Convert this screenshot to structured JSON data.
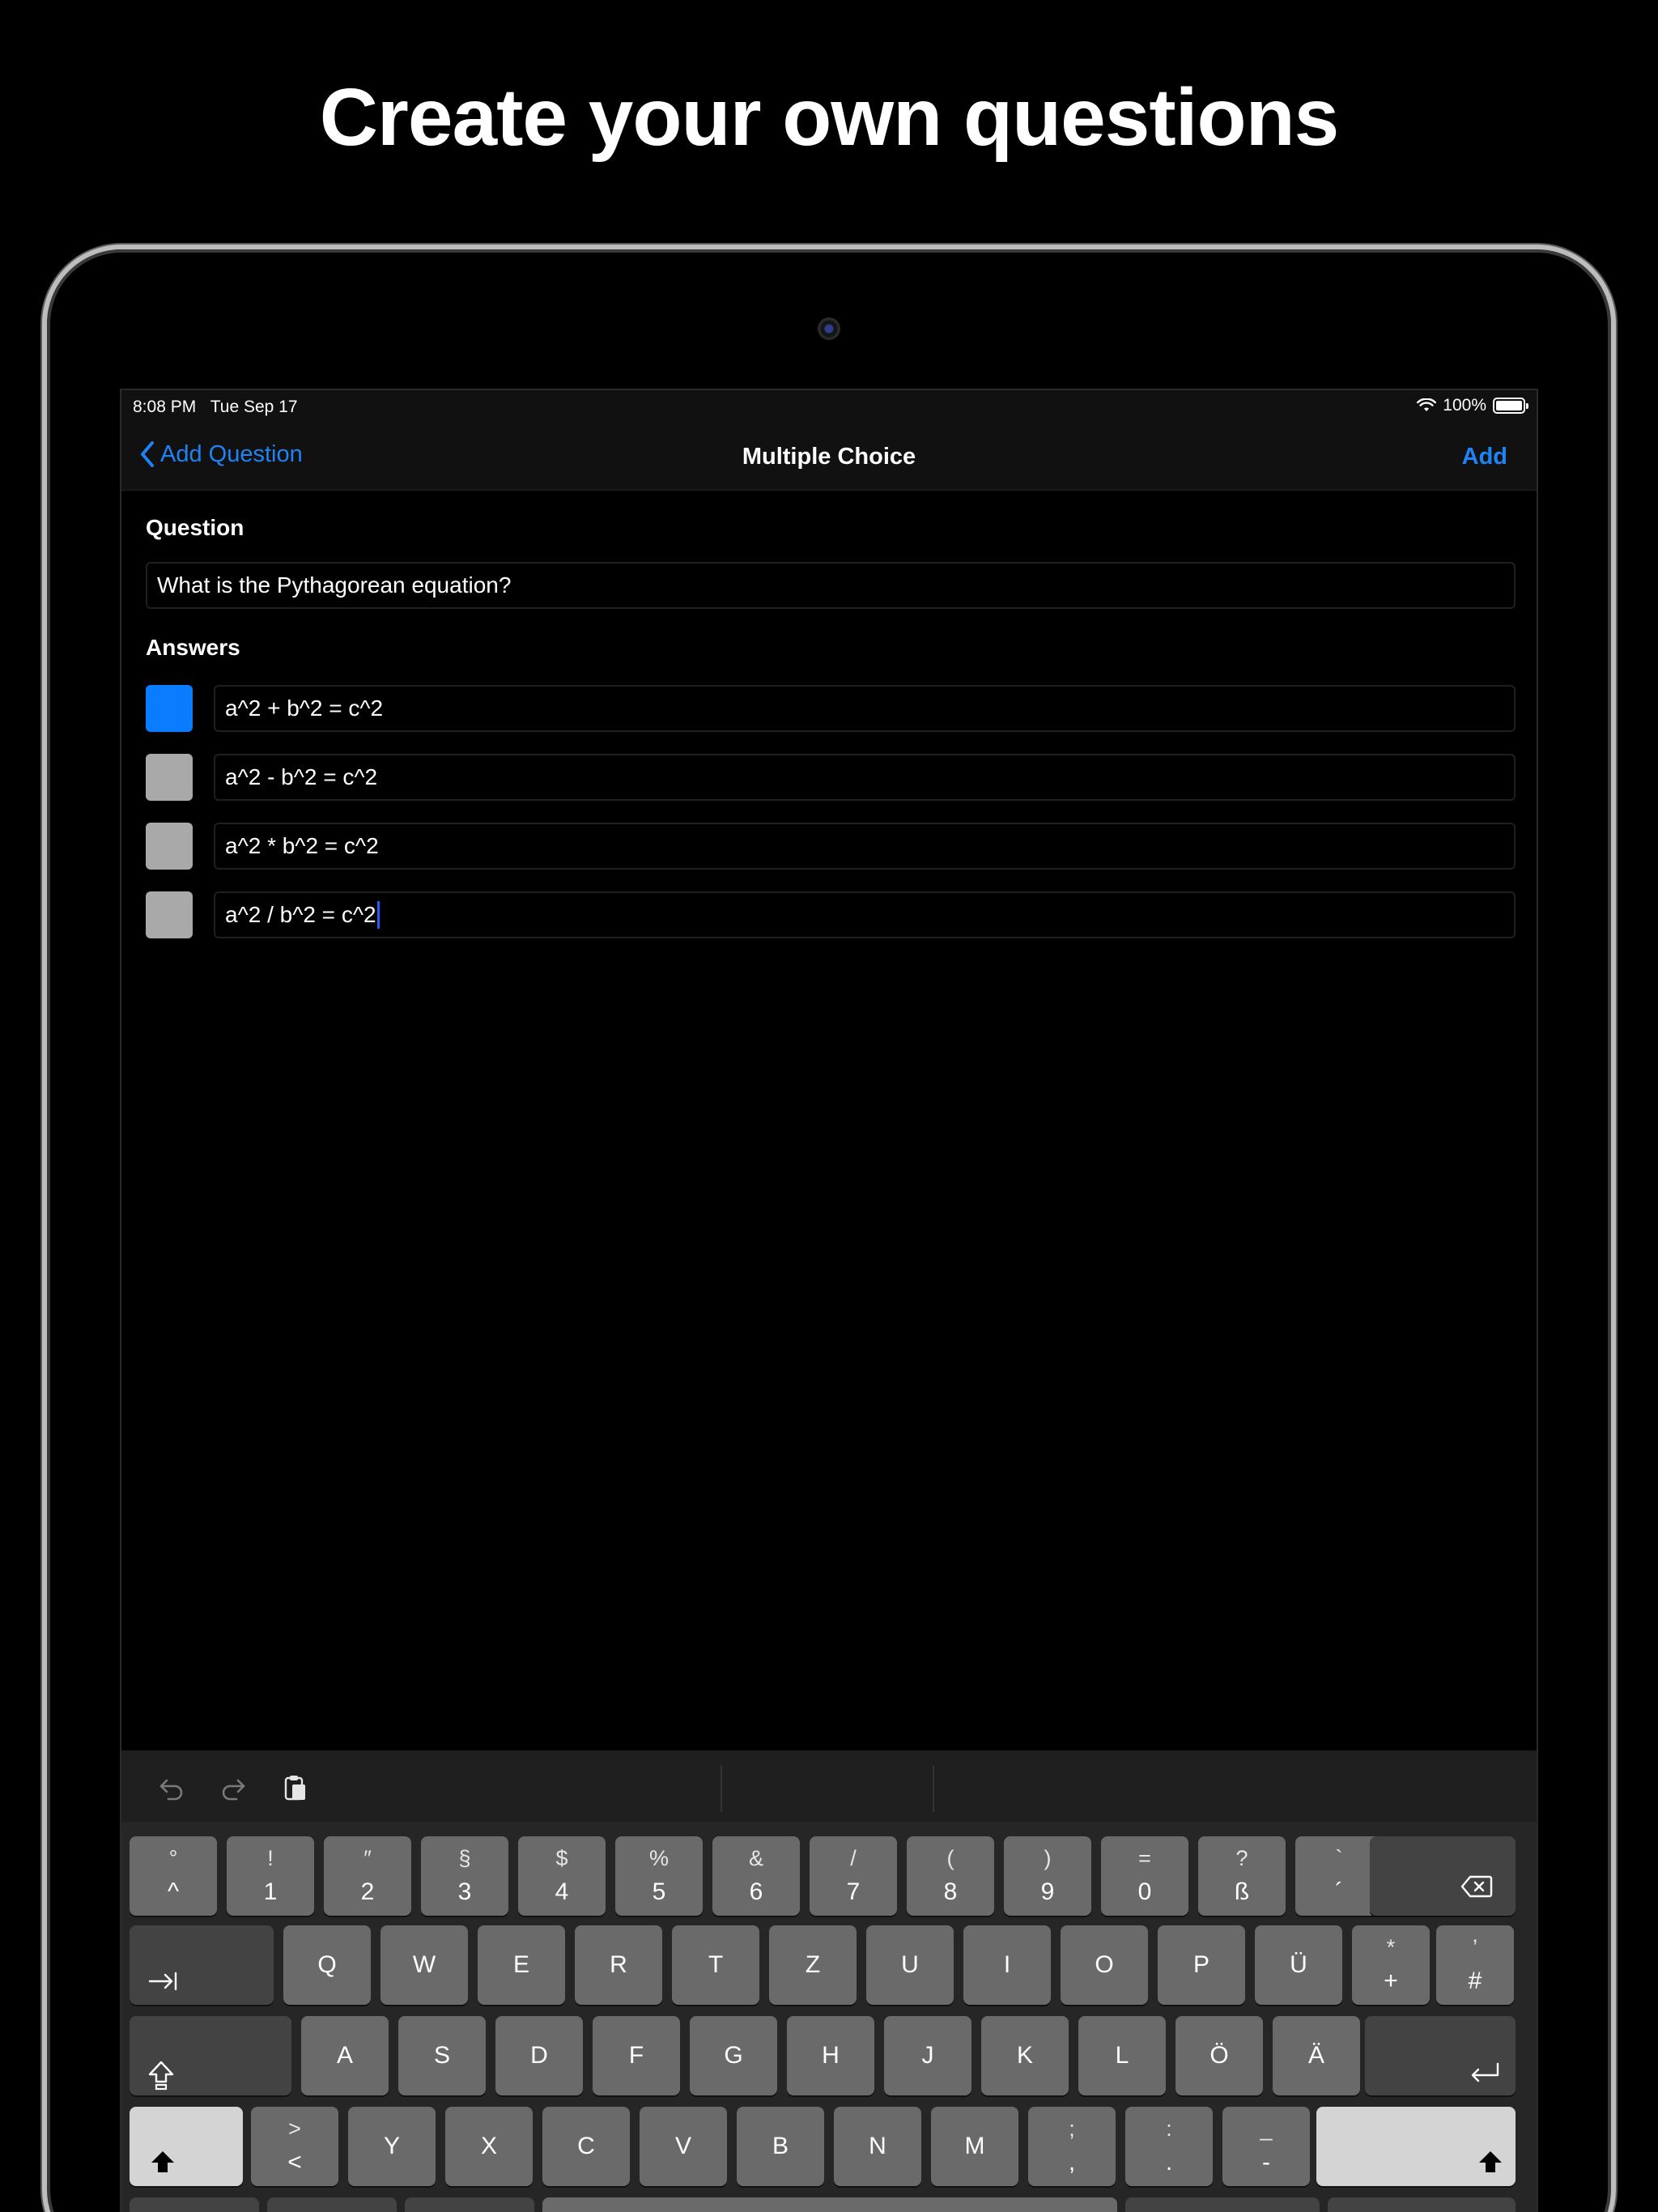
{
  "headline": "Create your own questions",
  "status": {
    "time": "8:08 PM",
    "date": "Tue Sep 17",
    "battery": "100%"
  },
  "nav": {
    "back_label": "Add Question",
    "title": "Multiple Choice",
    "add_label": "Add"
  },
  "question": {
    "label": "Question",
    "value": "What is the Pythagorean equation?"
  },
  "answers": {
    "label": "Answers",
    "items": [
      {
        "text": "a^2 + b^2 = c^2",
        "correct": true
      },
      {
        "text": "a^2 - b^2 = c^2",
        "correct": false
      },
      {
        "text": "a^2 * b^2 = c^2",
        "correct": false
      },
      {
        "text": "a^2 / b^2 = c^2",
        "correct": false
      }
    ]
  },
  "colors": {
    "accent": "#1e83f5",
    "selected": "#0a7cff",
    "unselected": "#a9a9a9"
  },
  "keyboard": {
    "row1": [
      {
        "top": "°",
        "bot": "^"
      },
      {
        "top": "!",
        "bot": "1"
      },
      {
        "top": "″",
        "bot": "2"
      },
      {
        "top": "§",
        "bot": "3"
      },
      {
        "top": "$",
        "bot": "4"
      },
      {
        "top": "%",
        "bot": "5"
      },
      {
        "top": "&",
        "bot": "6"
      },
      {
        "top": "/",
        "bot": "7"
      },
      {
        "top": "(",
        "bot": "8"
      },
      {
        "top": ")",
        "bot": "9"
      },
      {
        "top": "=",
        "bot": "0"
      },
      {
        "top": "?",
        "bot": "ß"
      },
      {
        "top": "`",
        "bot": "´"
      }
    ],
    "row2": [
      "Q",
      "W",
      "E",
      "R",
      "T",
      "Z",
      "U",
      "I",
      "O",
      "P",
      "Ü"
    ],
    "row2_extra": [
      {
        "top": "*",
        "bot": "+"
      },
      {
        "top": "’",
        "bot": "#"
      }
    ],
    "row3": [
      "A",
      "S",
      "D",
      "F",
      "G",
      "H",
      "J",
      "K",
      "L",
      "Ö",
      "Ä"
    ],
    "row4_first": {
      "top": ">",
      "bot": "<"
    },
    "row4": [
      "Y",
      "X",
      "C",
      "V",
      "B",
      "N",
      "M"
    ],
    "row4_extra": [
      {
        "top": ";",
        "bot": ","
      },
      {
        "top": ":",
        "bot": "."
      },
      {
        "top": "_",
        "bot": "-"
      }
    ],
    "icons": {
      "undo": "undo-icon",
      "redo": "redo-icon",
      "paste": "paste-icon",
      "delete": "delete-icon",
      "tab": "tab-icon",
      "caps": "caps-lock-icon",
      "return": "return-icon",
      "shift": "shift-icon"
    }
  }
}
